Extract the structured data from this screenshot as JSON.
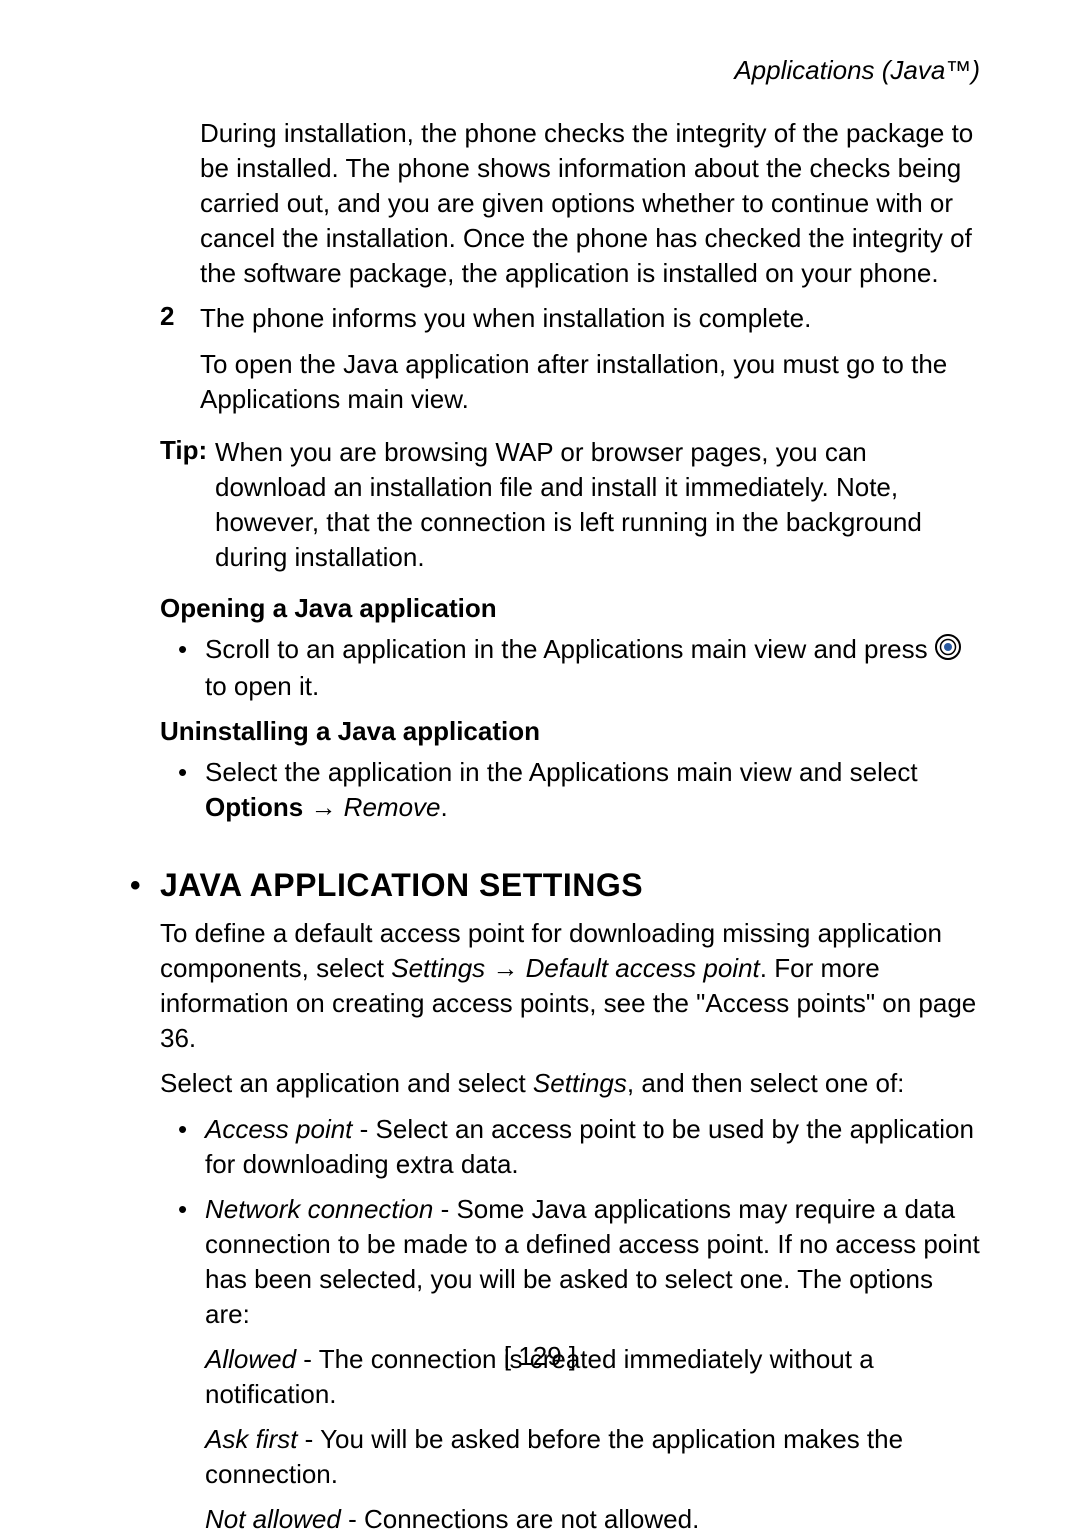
{
  "header": "Applications (Java™)",
  "intro": {
    "para1": "During installation, the phone checks the integrity of the package to be installed. The phone shows information about the checks being carried out, and you are given options whether to continue with or cancel the installation. Once the phone has checked the integrity of the software package, the application is installed on your phone."
  },
  "step2": {
    "num": "2",
    "line1": "The phone informs you when installation is complete.",
    "line2": "To open the Java application after installation, you must go to the Applications main view."
  },
  "tip": {
    "label": "Tip:",
    "text": "When you are browsing WAP or browser pages, you can download an installation file and install it immediately. Note, however, that the connection is left running in the background during installation."
  },
  "open": {
    "heading": "Opening a Java application",
    "bullet1_a": "Scroll to an application in the Applications main view and press ",
    "bullet1_b": " to open it."
  },
  "uninstall": {
    "heading": "Uninstalling a Java application",
    "bullet1_a": "Select the application in the Applications main view and select ",
    "options": "Options",
    "arrow": " → ",
    "remove": "Remove",
    "period": "."
  },
  "section": {
    "title": " JAVA APPLICATION SETTINGS",
    "p1_a": "To define a default access point for downloading missing application components, select ",
    "p1_settings": "Settings",
    "p1_arrow": " → ",
    "p1_dap": "Default access point",
    "p1_b": ". For more information on creating access points, see the \"Access points\" on page 36.",
    "p2_a": "Select an application and select ",
    "p2_settings": "Settings",
    "p2_b": ", and then select one of:",
    "opt1_label": "Access point",
    "opt1_text": " - Select an access point to be used by the application for downloading extra data.",
    "opt2_label": "Network connection",
    "opt2_text": " - Some Java applications may require a data connection to be made to a defined access point. If no access point has been selected, you will be asked to select one. The options are:",
    "sub1_label": "Allowed",
    "sub1_text": " - The connection is created immediately without a notification.",
    "sub2_label": "Ask first",
    "sub2_text": " - You will be asked before the application makes the connection.",
    "sub3_label": "Not allowed",
    "sub3_text": " - Connections are not allowed."
  },
  "footer": "[ 129 ]"
}
